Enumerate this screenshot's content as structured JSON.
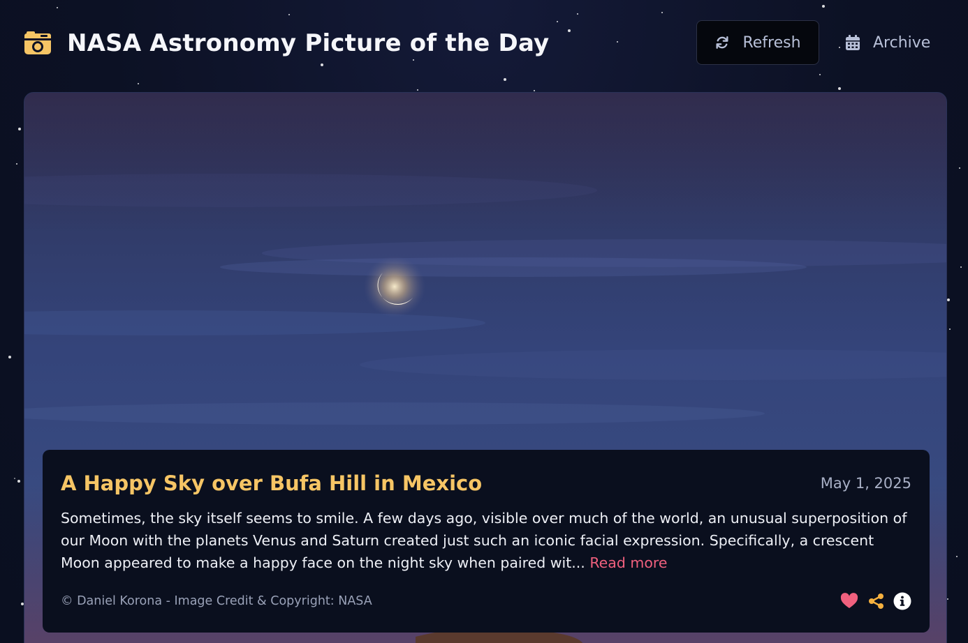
{
  "header": {
    "app_title": "NASA Astronomy Picture of the Day",
    "refresh_label": "Refresh",
    "archive_label": "Archive"
  },
  "apod": {
    "title": "A Happy Sky over Bufa Hill in Mexico",
    "date": "May 1, 2025",
    "description": "Sometimes, the sky itself seems to smile. A few days ago, visible over much of the world, an unusual superposition of our Moon with the planets Venus and Saturn created just such an iconic facial expression. Specifically, a crescent Moon appeared to make a happy face on the night sky when paired wit...",
    "read_more_label": "Read more",
    "credit": "© Daniel Korona - Image Credit & Copyright: NASA"
  },
  "icons": {
    "logo": "camera-retro-icon",
    "refresh": "refresh-icon",
    "archive": "calendar-icon",
    "like": "heart-icon",
    "share": "share-icon",
    "info": "info-icon"
  },
  "colors": {
    "accent_yellow": "#f6c565",
    "accent_pink": "#f0607e",
    "heart": "#f0607e",
    "share": "#f6b13f",
    "panel_bg": "#0a0f1e"
  }
}
